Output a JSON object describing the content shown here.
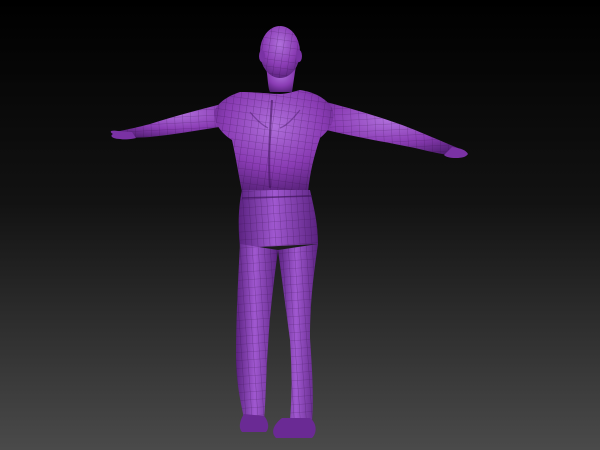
{
  "viewport": {
    "background": {
      "top_color": "#000000",
      "bottom_color": "#4a4a4a"
    },
    "model": {
      "subject": "t-pose-human-figure-back-view",
      "display_mode": "polygroup-wireframe",
      "base_color": "#8a3cb4",
      "highlight_color": "#b070dc",
      "shadow_color": "#4a1a6a",
      "wire_color": "#2a0a3a"
    }
  }
}
